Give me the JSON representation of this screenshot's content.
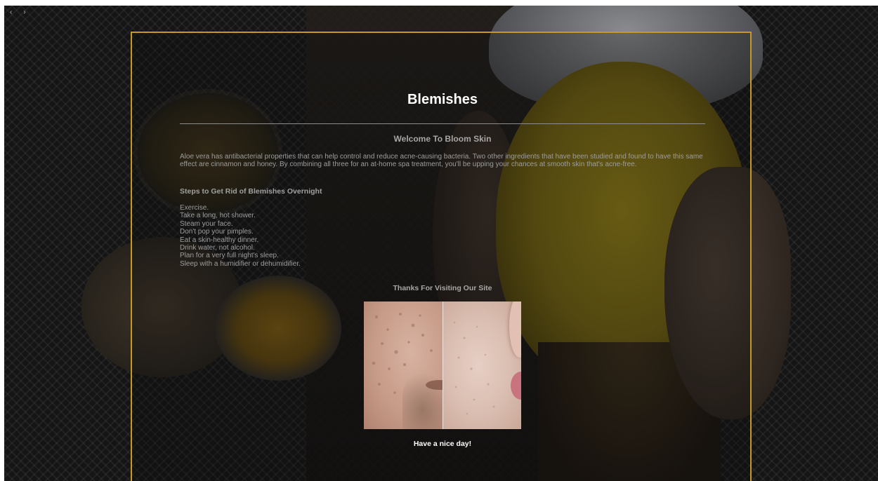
{
  "browser": {
    "back_icon": "chevron-left-icon",
    "forward_icon": "chevron-right-icon",
    "back_glyph": "‹",
    "forward_glyph": "›"
  },
  "page": {
    "title": "Blemishes",
    "subtitle": "Welcome To Bloom Skin",
    "intro": "Aloe vera has antibacterial properties that can help control and reduce acne-causing bacteria. Two other ingredients that have been studied and found to have this same effect are cinnamon and honey. By combining all three for an at-home spa treatment, you'll be upping your chances at smooth skin that's acne-free.",
    "steps_heading": "Steps to Get Rid of Blemishes Overnight",
    "steps": [
      "Exercise.",
      "Take a long, hot shower.",
      "Steam your face.",
      "Don't pop your pimples.",
      "Eat a skin-healthy dinner.",
      "Drink water, not alcohol.",
      "Plan for a very full night's sleep.",
      "Sleep with a humidifier or dehumidifier."
    ],
    "thanks": "Thanks For Visiting Our Site",
    "goodbye": "Have a nice day!"
  },
  "colors": {
    "frame_border": "#c49a22",
    "page_background": "#151515",
    "heading_text": "#ffffff",
    "body_text": "#9d9d9d"
  }
}
